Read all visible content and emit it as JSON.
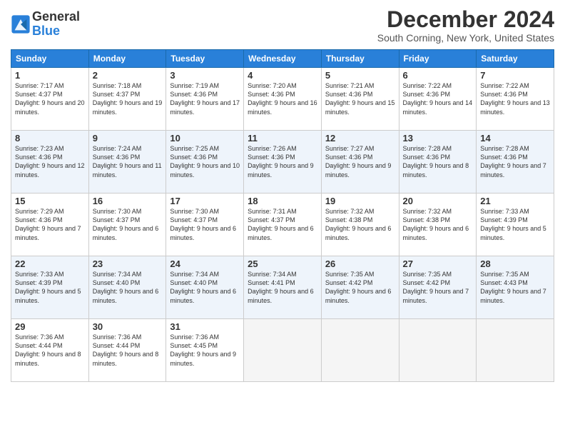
{
  "logo": {
    "general": "General",
    "blue": "Blue"
  },
  "title": "December 2024",
  "location": "South Corning, New York, United States",
  "days_of_week": [
    "Sunday",
    "Monday",
    "Tuesday",
    "Wednesday",
    "Thursday",
    "Friday",
    "Saturday"
  ],
  "weeks": [
    [
      {
        "day": "1",
        "sunrise": "7:17 AM",
        "sunset": "4:37 PM",
        "daylight": "9 hours and 20 minutes."
      },
      {
        "day": "2",
        "sunrise": "7:18 AM",
        "sunset": "4:37 PM",
        "daylight": "9 hours and 19 minutes."
      },
      {
        "day": "3",
        "sunrise": "7:19 AM",
        "sunset": "4:36 PM",
        "daylight": "9 hours and 17 minutes."
      },
      {
        "day": "4",
        "sunrise": "7:20 AM",
        "sunset": "4:36 PM",
        "daylight": "9 hours and 16 minutes."
      },
      {
        "day": "5",
        "sunrise": "7:21 AM",
        "sunset": "4:36 PM",
        "daylight": "9 hours and 15 minutes."
      },
      {
        "day": "6",
        "sunrise": "7:22 AM",
        "sunset": "4:36 PM",
        "daylight": "9 hours and 14 minutes."
      },
      {
        "day": "7",
        "sunrise": "7:22 AM",
        "sunset": "4:36 PM",
        "daylight": "9 hours and 13 minutes."
      }
    ],
    [
      {
        "day": "8",
        "sunrise": "7:23 AM",
        "sunset": "4:36 PM",
        "daylight": "9 hours and 12 minutes."
      },
      {
        "day": "9",
        "sunrise": "7:24 AM",
        "sunset": "4:36 PM",
        "daylight": "9 hours and 11 minutes."
      },
      {
        "day": "10",
        "sunrise": "7:25 AM",
        "sunset": "4:36 PM",
        "daylight": "9 hours and 10 minutes."
      },
      {
        "day": "11",
        "sunrise": "7:26 AM",
        "sunset": "4:36 PM",
        "daylight": "9 hours and 9 minutes."
      },
      {
        "day": "12",
        "sunrise": "7:27 AM",
        "sunset": "4:36 PM",
        "daylight": "9 hours and 9 minutes."
      },
      {
        "day": "13",
        "sunrise": "7:28 AM",
        "sunset": "4:36 PM",
        "daylight": "9 hours and 8 minutes."
      },
      {
        "day": "14",
        "sunrise": "7:28 AM",
        "sunset": "4:36 PM",
        "daylight": "9 hours and 7 minutes."
      }
    ],
    [
      {
        "day": "15",
        "sunrise": "7:29 AM",
        "sunset": "4:36 PM",
        "daylight": "9 hours and 7 minutes."
      },
      {
        "day": "16",
        "sunrise": "7:30 AM",
        "sunset": "4:37 PM",
        "daylight": "9 hours and 6 minutes."
      },
      {
        "day": "17",
        "sunrise": "7:30 AM",
        "sunset": "4:37 PM",
        "daylight": "9 hours and 6 minutes."
      },
      {
        "day": "18",
        "sunrise": "7:31 AM",
        "sunset": "4:37 PM",
        "daylight": "9 hours and 6 minutes."
      },
      {
        "day": "19",
        "sunrise": "7:32 AM",
        "sunset": "4:38 PM",
        "daylight": "9 hours and 6 minutes."
      },
      {
        "day": "20",
        "sunrise": "7:32 AM",
        "sunset": "4:38 PM",
        "daylight": "9 hours and 6 minutes."
      },
      {
        "day": "21",
        "sunrise": "7:33 AM",
        "sunset": "4:39 PM",
        "daylight": "9 hours and 5 minutes."
      }
    ],
    [
      {
        "day": "22",
        "sunrise": "7:33 AM",
        "sunset": "4:39 PM",
        "daylight": "9 hours and 5 minutes."
      },
      {
        "day": "23",
        "sunrise": "7:34 AM",
        "sunset": "4:40 PM",
        "daylight": "9 hours and 6 minutes."
      },
      {
        "day": "24",
        "sunrise": "7:34 AM",
        "sunset": "4:40 PM",
        "daylight": "9 hours and 6 minutes."
      },
      {
        "day": "25",
        "sunrise": "7:34 AM",
        "sunset": "4:41 PM",
        "daylight": "9 hours and 6 minutes."
      },
      {
        "day": "26",
        "sunrise": "7:35 AM",
        "sunset": "4:42 PM",
        "daylight": "9 hours and 6 minutes."
      },
      {
        "day": "27",
        "sunrise": "7:35 AM",
        "sunset": "4:42 PM",
        "daylight": "9 hours and 7 minutes."
      },
      {
        "day": "28",
        "sunrise": "7:35 AM",
        "sunset": "4:43 PM",
        "daylight": "9 hours and 7 minutes."
      }
    ],
    [
      {
        "day": "29",
        "sunrise": "7:36 AM",
        "sunset": "4:44 PM",
        "daylight": "9 hours and 8 minutes."
      },
      {
        "day": "30",
        "sunrise": "7:36 AM",
        "sunset": "4:44 PM",
        "daylight": "9 hours and 8 minutes."
      },
      {
        "day": "31",
        "sunrise": "7:36 AM",
        "sunset": "4:45 PM",
        "daylight": "9 hours and 9 minutes."
      },
      null,
      null,
      null,
      null
    ]
  ]
}
